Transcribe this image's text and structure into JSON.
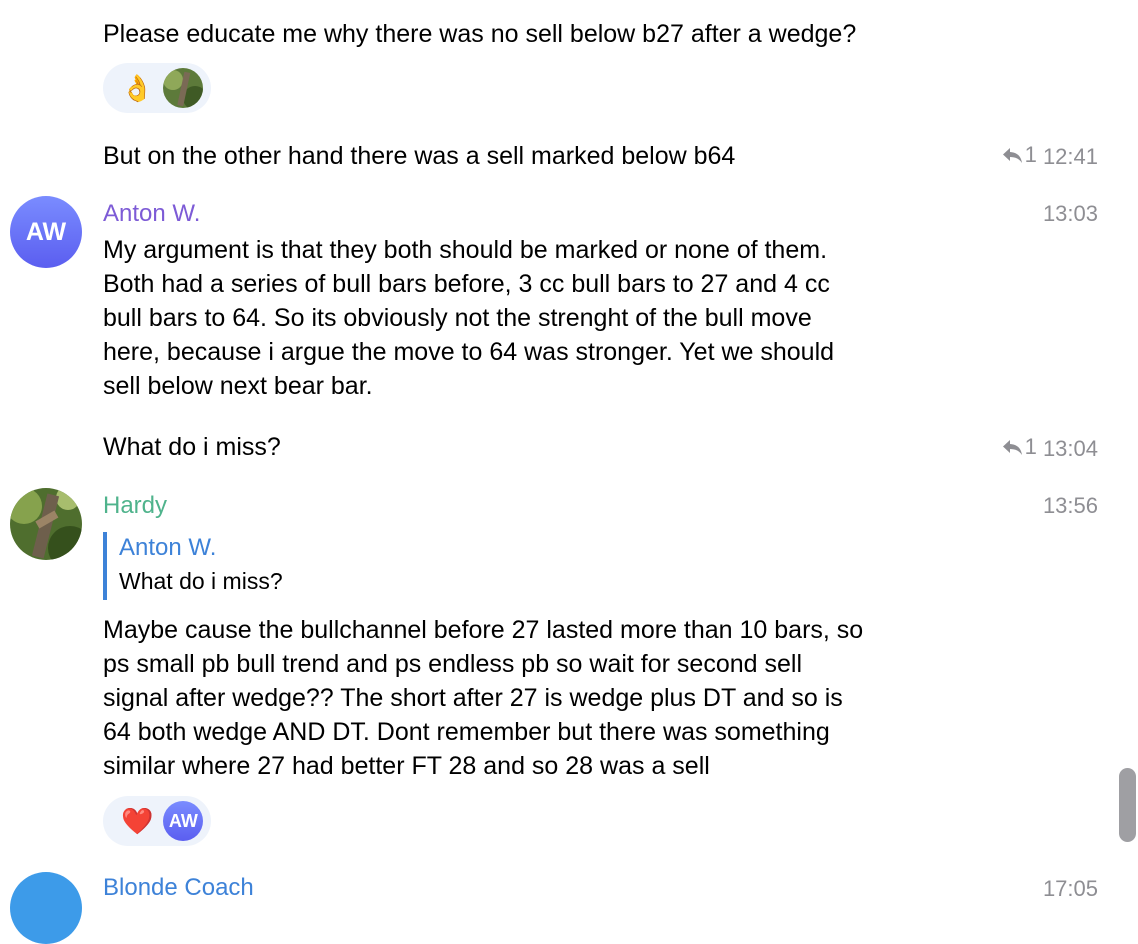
{
  "messages": {
    "m1_text": "Please educate me why there was no sell below b27 after a wedge?",
    "m2_text": "But on the other hand there was a sell marked below b64",
    "m2_reply_count": "1",
    "m2_time": "12:41",
    "anton": {
      "avatar_initials": "AW",
      "name": "Anton W.",
      "time": "13:03",
      "text_lines": [
        "My argument is that they both should be marked or none of them.",
        "Both had a series of bull bars before, 3 cc bull bars to 27 and 4 cc",
        "bull bars to 64. So its obviously not the strenght of the bull move",
        "here, because i argue the move to 64 was stronger. Yet we should",
        "sell below next bear bar."
      ],
      "followup_text": "What do i miss?",
      "followup_reply_count": "1",
      "followup_time": "13:04"
    },
    "hardy": {
      "name": "Hardy",
      "time": "13:56",
      "reply_to_name": "Anton W.",
      "reply_to_text": "What do i miss?",
      "text_lines": [
        "Maybe cause the bullchannel before 27 lasted more than 10 bars, so",
        "ps small pb bull trend and ps endless pb so wait for second sell",
        "signal after wedge?? The short after 27 is wedge plus DT and so is",
        "64 both wedge AND DT. Dont remember but there was something",
        "similar where 27 had better FT 28 and so 28 was a sell"
      ]
    },
    "next": {
      "name": "Blonde Coach",
      "time": "17:05"
    }
  },
  "reactions": {
    "first": {
      "emoji": "👌",
      "icon": "ok-hand-icon"
    },
    "second": {
      "emoji": "❤️",
      "icon": "heart-icon",
      "reactor_initials": "AW"
    }
  },
  "colors": {
    "anton_name": "#7d5bd6",
    "hardy_name": "#4fb38c",
    "next_name": "#3d82d8",
    "reply_accent": "#3d82d8",
    "timestamp": "#8e8e93",
    "reaction_bg": "#eef3fb"
  }
}
